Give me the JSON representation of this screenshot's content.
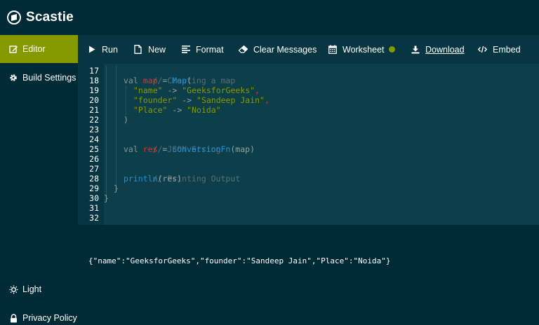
{
  "app": {
    "title": "Scastie"
  },
  "sidebar": {
    "editor_label": "Editor",
    "build_settings_label": "Build Settings",
    "light_label": "Light",
    "privacy_label": "Privacy Policy"
  },
  "toolbar": {
    "run_label": "Run",
    "new_label": "New",
    "format_label": "Format",
    "clear_label": "Clear Messages",
    "worksheet_label": "Worksheet",
    "download_label": "Download",
    "embed_label": "Embed"
  },
  "editor": {
    "line_numbers": [
      "17",
      "18",
      "19",
      "20",
      "21",
      "22",
      "23",
      "24",
      "25",
      "26",
      "27",
      "28",
      "29",
      "30",
      "31",
      "32"
    ],
    "lines": {
      "l17": {
        "comment": "// Creating a map"
      },
      "l18": {
        "kw": "val",
        "var": "map",
        "op": " = ",
        "fn": "Map",
        "punct": "("
      },
      "l19": {
        "str1": "\"name\"",
        "op": " -> ",
        "str2": "\"GeeksforGeeks\"",
        "punct": ","
      },
      "l20": {
        "str1": "\"founder\"",
        "op": " -> ",
        "str2": "\"Sandeep Jain\"",
        "punct": ","
      },
      "l21": {
        "str1": "\"Place\"",
        "op": " -> ",
        "str2": "\"Noida\""
      },
      "l22": {
        "punct": ")"
      },
      "l24": {
        "comment": "// JSON String"
      },
      "l25": {
        "kw": "val",
        "var": "res",
        "op": " = ",
        "fn": "conversionFn",
        "arg": "(map)"
      },
      "l27": {
        "comment": "// Printing Output"
      },
      "l28": {
        "fn": "println",
        "arg": "(res)"
      },
      "l29": {
        "punct": "}"
      },
      "l30": {
        "punct": "}"
      }
    }
  },
  "console": {
    "output": "{\"name\":\"GeeksforGeeks\",\"founder\":\"Sandeep Jain\",\"Place\":\"Noida\"}"
  },
  "colors": {
    "accent": "#859900",
    "background": "#002b36",
    "toolbar": "#073642",
    "editor": "#0d3f4a"
  }
}
